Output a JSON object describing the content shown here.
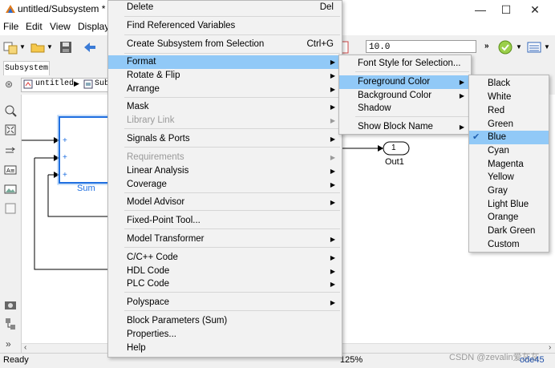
{
  "window": {
    "title": "untitled/Subsystem * -",
    "controls": [
      "—",
      "☐",
      "✕"
    ]
  },
  "menubar": {
    "items": [
      "File",
      "Edit",
      "View",
      "Display"
    ]
  },
  "toolbar": {
    "time_value": "10.0"
  },
  "tab": {
    "label": "Subsystem"
  },
  "breadcrumb": {
    "root": "untitled",
    "child": "Sub"
  },
  "diagram": {
    "sum_label": "Sum",
    "plus": "+",
    "out_port_number": "1",
    "out_port_label": "Out1"
  },
  "status": {
    "left": "Ready",
    "zoom": "125%",
    "solver": "ode45",
    "watermark": "CSDN @zevalin爱灰灰"
  },
  "context_menu": {
    "items": [
      {
        "label": "Delete",
        "accel": "Del"
      },
      {
        "label": "Find Referenced Variables"
      },
      {
        "label": "Create Subsystem from Selection",
        "accel": "Ctrl+G"
      },
      {
        "label": "Format",
        "submenu": true
      },
      {
        "label": "Rotate & Flip",
        "submenu": true
      },
      {
        "label": "Arrange",
        "submenu": true
      },
      {
        "label": "Mask",
        "submenu": true
      },
      {
        "label": "Library Link",
        "submenu": true
      },
      {
        "label": "Signals & Ports",
        "submenu": true
      },
      {
        "label": "Requirements",
        "submenu": true
      },
      {
        "label": "Linear Analysis",
        "submenu": true
      },
      {
        "label": "Coverage",
        "submenu": true
      },
      {
        "label": "Model Advisor",
        "submenu": true
      },
      {
        "label": "Fixed-Point Tool..."
      },
      {
        "label": "Model Transformer",
        "submenu": true
      },
      {
        "label": "C/C++ Code",
        "submenu": true
      },
      {
        "label": "HDL Code",
        "submenu": true
      },
      {
        "label": "PLC Code",
        "submenu": true
      },
      {
        "label": "Polyspace",
        "submenu": true
      },
      {
        "label": "Block Parameters (Sum)"
      },
      {
        "label": "Properties..."
      },
      {
        "label": "Help"
      }
    ]
  },
  "format_menu": {
    "items": [
      {
        "label": "Font Style for Selection..."
      },
      {
        "label": "Foreground Color",
        "submenu": true
      },
      {
        "label": "Background Color",
        "submenu": true
      },
      {
        "label": "Shadow"
      },
      {
        "label": "Show Block Name",
        "submenu": true
      }
    ]
  },
  "color_menu": {
    "selected": "Blue",
    "items": [
      "Black",
      "White",
      "Red",
      "Green",
      "Blue",
      "Cyan",
      "Magenta",
      "Yellow",
      "Gray",
      "Light Blue",
      "Orange",
      "Dark Green",
      "Custom"
    ]
  },
  "colors": {
    "highlight": "#91c9f7",
    "block_blue": "#1f6fe0",
    "menu_bg": "#f2f2f2"
  }
}
